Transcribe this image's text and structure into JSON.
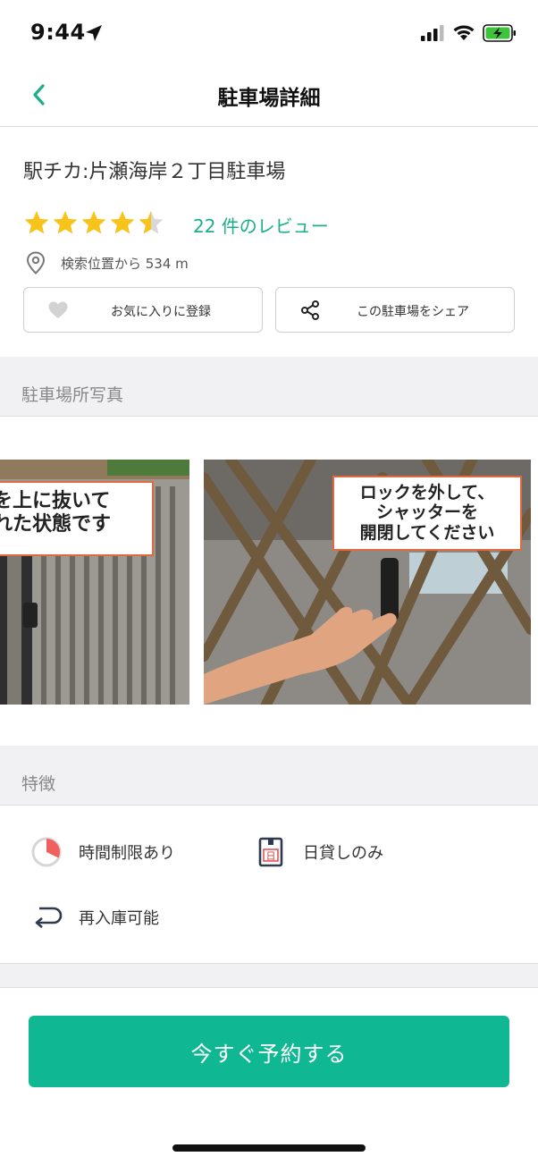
{
  "status_bar": {
    "time": "9:44"
  },
  "header": {
    "title": "駐車場詳細"
  },
  "lot": {
    "name": "駅チカ:片瀬海岸２丁目駐車場",
    "rating": 4.5,
    "rating_max": 5,
    "review_link": "22 件のレビュー",
    "distance": "検索位置から 534 m"
  },
  "actions": {
    "favorite_label": "お気に入りに登録",
    "share_label": "この駐車場をシェア"
  },
  "sections": {
    "photos_title": "駐車場所写真",
    "features_title": "特徴"
  },
  "photos": [
    {
      "caption_line1": "を上に抜いて",
      "caption_line2": "れた状態です"
    },
    {
      "caption_line1": "ロックを外して、",
      "caption_line2": "シャッターを",
      "caption_line3": "開閉してください"
    }
  ],
  "features": {
    "time_limit": "時間制限あり",
    "daily_only": "日貸しのみ",
    "daily_badge": "日",
    "reentry": "再入庫可能"
  },
  "reserve_button": "今すぐ予約する",
  "colors": {
    "accent": "#0fb893",
    "link": "#1aaf8b",
    "star": "#f7c31b",
    "bubble_border": "#e0693e"
  }
}
